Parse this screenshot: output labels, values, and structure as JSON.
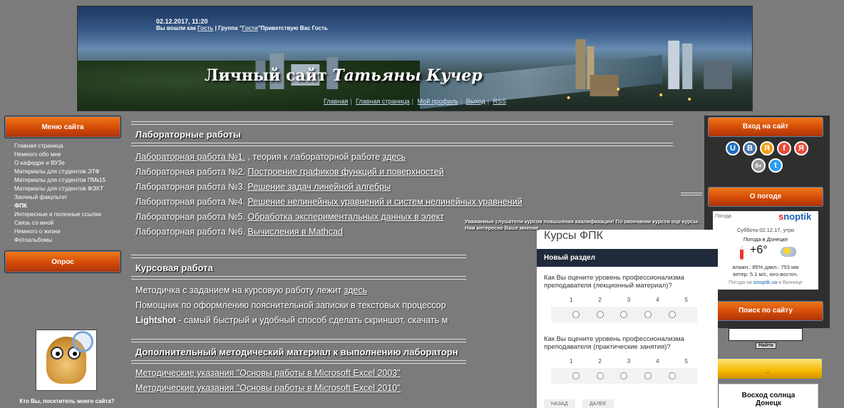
{
  "header": {
    "datetime": "02.12.2017, 11:20",
    "login_prefix": "Вы вошли как",
    "login_user": "Гость",
    "group_prefix": "| Группа \"",
    "group_name": "Гости",
    "greeting": "\"Приветствую Вас Гость",
    "title_plain": "Личный сайт",
    "title_italic": "Татьяны Кучер",
    "nav": [
      "Главная",
      "Главная страница",
      "Мой профиль",
      "Выход",
      "RSS"
    ]
  },
  "left_menu": {
    "title": "Меню сайта",
    "items": [
      "Главная страница",
      "Немного обо мне",
      "О кафедре и ВУЗе",
      "Материалы для студентов ЭТФ",
      "Материалы для студентов ПМк15",
      "Материалы для студентов ФЭХТ",
      "Заочный факультет",
      "ФПК",
      "Интересные и полезные ссылки",
      "Связь со мной",
      "Немного о жизни",
      "Фотоальбомы"
    ],
    "poll_title": "Опрос",
    "poll_caption": "Кто Вы, посетитель моего сайта?"
  },
  "main": {
    "lab_title": "Лабораторные работы",
    "labs": [
      {
        "prefix": "Лабораторная работа №1.",
        "middle": " , теория к лабораторной работе ",
        "link": "здесь"
      },
      {
        "prefix": "Лабораторная работа №2. ",
        "link": "Построение графиков функций и поверхностей"
      },
      {
        "prefix": "Лабораторная работа №3. ",
        "link": "Решение задач линейной алгебры"
      },
      {
        "prefix": "Лабораторная работа №4. ",
        "link": "Решение нелинейных уравнений и систем нелинейных уравнений"
      },
      {
        "prefix": "Лабораторная работа №5. ",
        "link": "Обработка экспериментальных данных в элект"
      },
      {
        "prefix": "Лабораторная работа №6. ",
        "link": "Вычисления в Mathcad"
      }
    ],
    "course_title": "Курсовая работа",
    "course_rows": [
      {
        "text": "Методичка с заданием на курсовую работу лежит ",
        "link": "здесь"
      },
      {
        "text": "Помощник по оформлению пояснительной записки в текстовых процессор"
      },
      {
        "bold": "Lightshot",
        "text": " - самый быстрый и удобный способ сделать скриншот, скачать м"
      }
    ],
    "extra_title": "Дополнительный методический материал к выполнению лабораторн",
    "extra_links": [
      "Методические указания \"Основы работы в Microsoft Excel 2003\"",
      "Методические указания \"Основы работы в Microsoft Excel 2010\""
    ]
  },
  "popup": {
    "notice": "Уважаемые слушатели курсов повышения квалификации! По окончании курсов оце курсы. Нам интересно Ваше мнение",
    "form_title": "Курсы ФПК",
    "section": "Новый раздел",
    "q1": "Как Вы оцените уровень профессионализма преподавателя (лекционный материал)?",
    "q2": "Как Вы оцените уровень профессионализма преподавателя (практические занятия)?",
    "scale": [
      "1",
      "2",
      "3",
      "4",
      "5"
    ],
    "btn_back": "НАЗАД",
    "btn_next": "ДАЛЕЕ"
  },
  "right": {
    "login_title": "Вход на сайт",
    "social": [
      {
        "label": "U",
        "color": "#1b6fc2"
      },
      {
        "label": "В",
        "color": "#4a76a8"
      },
      {
        "label": "Я",
        "color": "#f39c12"
      },
      {
        "label": "f",
        "color": "#e74c3c"
      },
      {
        "label": "Я",
        "color": "#e74c3c"
      },
      {
        "label": "8+",
        "color": "#999999"
      },
      {
        "label": "t",
        "color": "#2a9df4"
      }
    ],
    "weather_title": "О погоде",
    "weather": {
      "label": "Погода",
      "logo_a": "s",
      "logo_b": "noptik",
      "date": "Суббота 02.12.17, утро",
      "city": "Погода в Донецке",
      "temp": "+6°",
      "humidity": "влажн.: 85%  давл.: 753 мм",
      "wind": "ветер: 5.1 м/с, юго-восточ.",
      "source_prefix": "Погода на ",
      "source_link": "sinoptik.ua",
      "source_suffix": " в Виннице"
    },
    "search_title": "Поиск по сайту",
    "search_button": "Найти",
    "sun_title": "Восход солнца",
    "sun_city": "Донецк"
  }
}
